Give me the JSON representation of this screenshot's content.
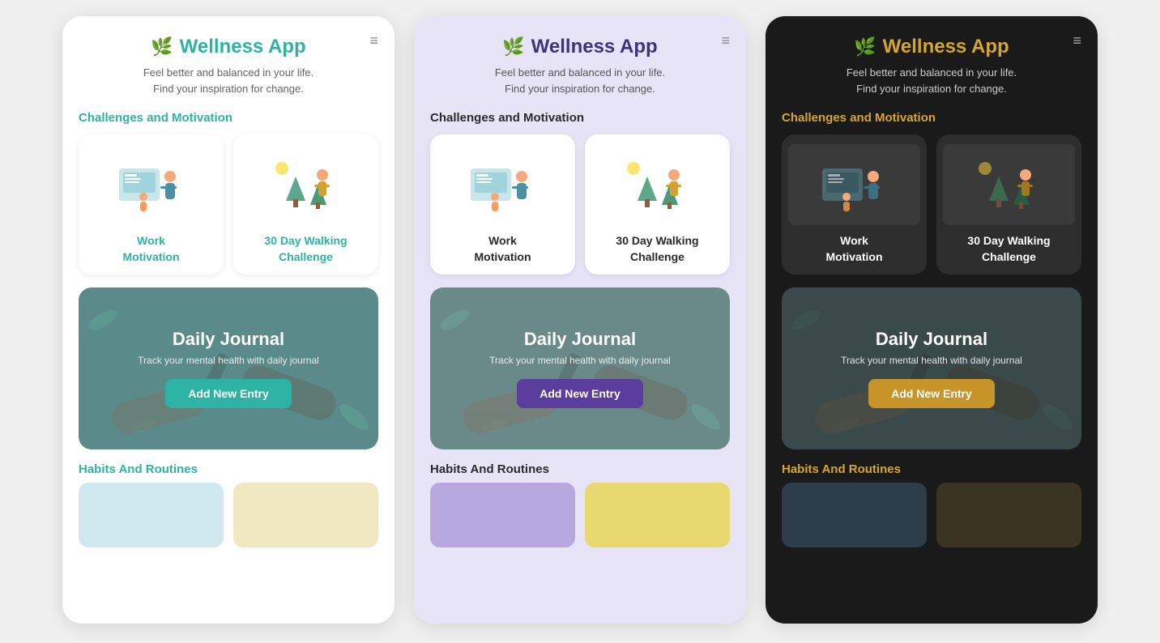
{
  "themes": [
    "light",
    "purple",
    "dark"
  ],
  "header": {
    "app_title": "Wellness App",
    "tagline": "Feel better and balanced in your life.\nFind your inspiration for change.",
    "menu_icon": "≡",
    "logo": "🌿"
  },
  "sections": {
    "challenges": {
      "title": "Challenges and Motivation",
      "cards": [
        {
          "label": "Work\nMotivation"
        },
        {
          "label": "30 Day Walking\nChallenge"
        }
      ]
    },
    "journal": {
      "title": "Daily Journal",
      "subtitle": "Track your mental health with daily journal",
      "button": "Add New Entry"
    },
    "habits": {
      "title": "Habits And Routines"
    }
  },
  "accent_light": "#2db3a4",
  "accent_purple": "#5b3d9e",
  "accent_dark": "#d4a72c"
}
